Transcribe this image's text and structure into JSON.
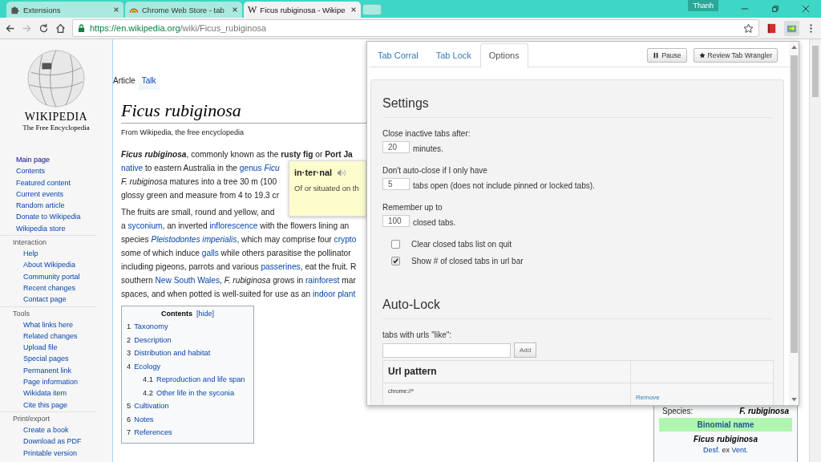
{
  "browser": {
    "tabs": [
      {
        "title": "Extensions",
        "selected": false
      },
      {
        "title": "Chrome Web Store - tab",
        "selected": false
      },
      {
        "title": "Ficus rubiginosa - Wikipe",
        "favicon": "W",
        "selected": true
      }
    ],
    "profile": "Thanh",
    "url": {
      "host": "https://en.wikipedia.org",
      "path": "/wiki/Ficus_rubiginosa"
    }
  },
  "sidebar": {
    "wordmark": "WIKIPEDIA",
    "tagline": "The Free Encyclopedia",
    "groups": [
      {
        "items": [
          {
            "label": "Main page",
            "visited": true
          },
          {
            "label": "Contents",
            "visited": false
          },
          {
            "label": "Featured content",
            "visited": false
          },
          {
            "label": "Current events",
            "visited": false
          },
          {
            "label": "Random article",
            "visited": false
          },
          {
            "label": "Donate to Wikipedia",
            "visited": false
          },
          {
            "label": "Wikipedia store",
            "visited": false
          }
        ]
      },
      {
        "heading": "Interaction",
        "items": [
          {
            "label": "Help",
            "visited": false
          },
          {
            "label": "About Wikipedia",
            "visited": false
          },
          {
            "label": "Community portal",
            "visited": false
          },
          {
            "label": "Recent changes",
            "visited": false
          },
          {
            "label": "Contact page",
            "visited": false
          }
        ]
      },
      {
        "heading": "Tools",
        "items": [
          {
            "label": "What links here",
            "visited": false
          },
          {
            "label": "Related changes",
            "visited": false
          },
          {
            "label": "Upload file",
            "visited": false
          },
          {
            "label": "Special pages",
            "visited": false
          },
          {
            "label": "Permanent link",
            "visited": false
          },
          {
            "label": "Page information",
            "visited": false
          },
          {
            "label": "Wikidata item",
            "visited": false
          },
          {
            "label": "Cite this page",
            "visited": false
          }
        ]
      },
      {
        "heading": "Print/export",
        "items": [
          {
            "label": "Create a book",
            "visited": false
          },
          {
            "label": "Download as PDF",
            "visited": false
          },
          {
            "label": "Printable version",
            "visited": false
          }
        ]
      }
    ]
  },
  "page_tabs": [
    {
      "label": "Article",
      "selected": true
    },
    {
      "label": "Talk",
      "selected": false
    }
  ],
  "article": {
    "title": "Ficus rubiginosa",
    "subtitle": "From Wikipedia, the free encyclopedia",
    "paragraphs": [
      {
        "lines": [
          [
            {
              "kind": "bold-italic",
              "text": "Ficus rubiginosa"
            },
            {
              "kind": "plain",
              "text": ", commonly known as the "
            },
            {
              "kind": "bold",
              "text": "rusty fig"
            },
            {
              "kind": "plain",
              "text": " or "
            },
            {
              "kind": "bold",
              "text": "Port Ja"
            }
          ],
          [
            {
              "kind": "link",
              "text": "native"
            },
            {
              "kind": "plain",
              "text": " to eastern Australia in the "
            },
            {
              "kind": "link",
              "text": "genus "
            },
            {
              "kind": "link-italic",
              "text": "Ficu"
            }
          ],
          [
            {
              "kind": "italic",
              "text": "F. rubiginosa"
            },
            {
              "kind": "plain",
              "text": " matures into a tree 30 m (100"
            }
          ],
          [
            {
              "kind": "plain",
              "text": "glossy green and measure from 4 to 19.3 cr"
            }
          ]
        ]
      },
      {
        "lines": [
          [
            {
              "kind": "plain",
              "text": "The fruits are small, round and yellow, and"
            }
          ],
          [
            {
              "kind": "plain",
              "text": "a "
            },
            {
              "kind": "link",
              "text": "syconium"
            },
            {
              "kind": "plain",
              "text": ", an inverted "
            },
            {
              "kind": "link",
              "text": "inflorescence"
            },
            {
              "kind": "plain",
              "text": " with the flowers lining an"
            }
          ],
          [
            {
              "kind": "plain",
              "text": "species "
            },
            {
              "kind": "link-italic",
              "text": "Pleistodontes imperialis"
            },
            {
              "kind": "plain",
              "text": ", which may comprise four "
            },
            {
              "kind": "link",
              "text": "crypto"
            }
          ],
          [
            {
              "kind": "plain",
              "text": "some of which induce "
            },
            {
              "kind": "link",
              "text": "galls"
            },
            {
              "kind": "plain",
              "text": " while others parasitise the pollinator"
            }
          ],
          [
            {
              "kind": "plain",
              "text": "including pigeons, parrots and various "
            },
            {
              "kind": "link",
              "text": "passerines"
            },
            {
              "kind": "plain",
              "text": ", eat the fruit. R"
            }
          ],
          [
            {
              "kind": "plain",
              "text": "southern "
            },
            {
              "kind": "link",
              "text": "New South Wales"
            },
            {
              "kind": "plain",
              "text": ", "
            },
            {
              "kind": "italic",
              "text": "F. rubiginosa"
            },
            {
              "kind": "plain",
              "text": " grows in "
            },
            {
              "kind": "link",
              "text": "rainforest"
            },
            {
              "kind": "plain",
              "text": " mar"
            }
          ],
          [
            {
              "kind": "plain",
              "text": "spaces, and when potted is well-suited for use as an "
            },
            {
              "kind": "link",
              "text": "indoor plant"
            }
          ]
        ]
      }
    ]
  },
  "toc": {
    "title": "Contents",
    "toggle": "[hide]",
    "items": [
      {
        "number": "1",
        "label": "Taxonomy"
      },
      {
        "number": "2",
        "label": "Description"
      },
      {
        "number": "3",
        "label": "Distribution and habitat"
      },
      {
        "number": "4",
        "label": "Ecology",
        "children": [
          {
            "number": "4.1",
            "label": "Reproduction and life span"
          },
          {
            "number": "4.2",
            "label": "Other life in the syconia"
          }
        ]
      },
      {
        "number": "5",
        "label": "Cultivation"
      },
      {
        "number": "6",
        "label": "Notes"
      },
      {
        "number": "7",
        "label": "References"
      }
    ]
  },
  "infobox": {
    "species_label": "Species:",
    "species": "F. rubiginosa",
    "section": "Binomial name",
    "binomial": "Ficus rubiginosa",
    "authority": [
      {
        "kind": "link",
        "text": "Desf."
      },
      {
        "kind": "plain",
        "text": " ex "
      },
      {
        "kind": "link",
        "text": "Vent."
      }
    ]
  },
  "dictionary": {
    "word": "in·ter·nal",
    "definition": "Of or situated on th"
  },
  "popup": {
    "tabs": [
      {
        "label": "Tab Corral",
        "selected": false
      },
      {
        "label": "Tab Lock",
        "selected": false
      },
      {
        "label": "Options",
        "selected": true
      }
    ],
    "buttons": [
      {
        "label": "Pause",
        "kind": "pause"
      },
      {
        "label": "Review Tab Wrangler",
        "kind": "star"
      }
    ],
    "settings": {
      "title": "Settings",
      "fields": [
        {
          "label": "Close inactive tabs after:",
          "value": "20",
          "suffix": "minutes."
        },
        {
          "label": "Don't auto-close if I only have",
          "value": "5",
          "suffix": "tabs open (does not include pinned or locked tabs)."
        },
        {
          "label": "Remember up to",
          "value": "100",
          "suffix": "closed tabs."
        }
      ],
      "options": [
        {
          "label": "Clear closed tabs list on quit",
          "checked": false
        },
        {
          "label": "Show # of closed tabs in url bar",
          "checked": true
        }
      ]
    },
    "auto_lock": {
      "title": "Auto-Lock",
      "label": "tabs with urls \"like\":",
      "add_button": "Add",
      "columns": [
        "Url pattern"
      ],
      "rows": [
        {
          "pattern": "chrome://*",
          "action": "Remove"
        }
      ]
    }
  }
}
